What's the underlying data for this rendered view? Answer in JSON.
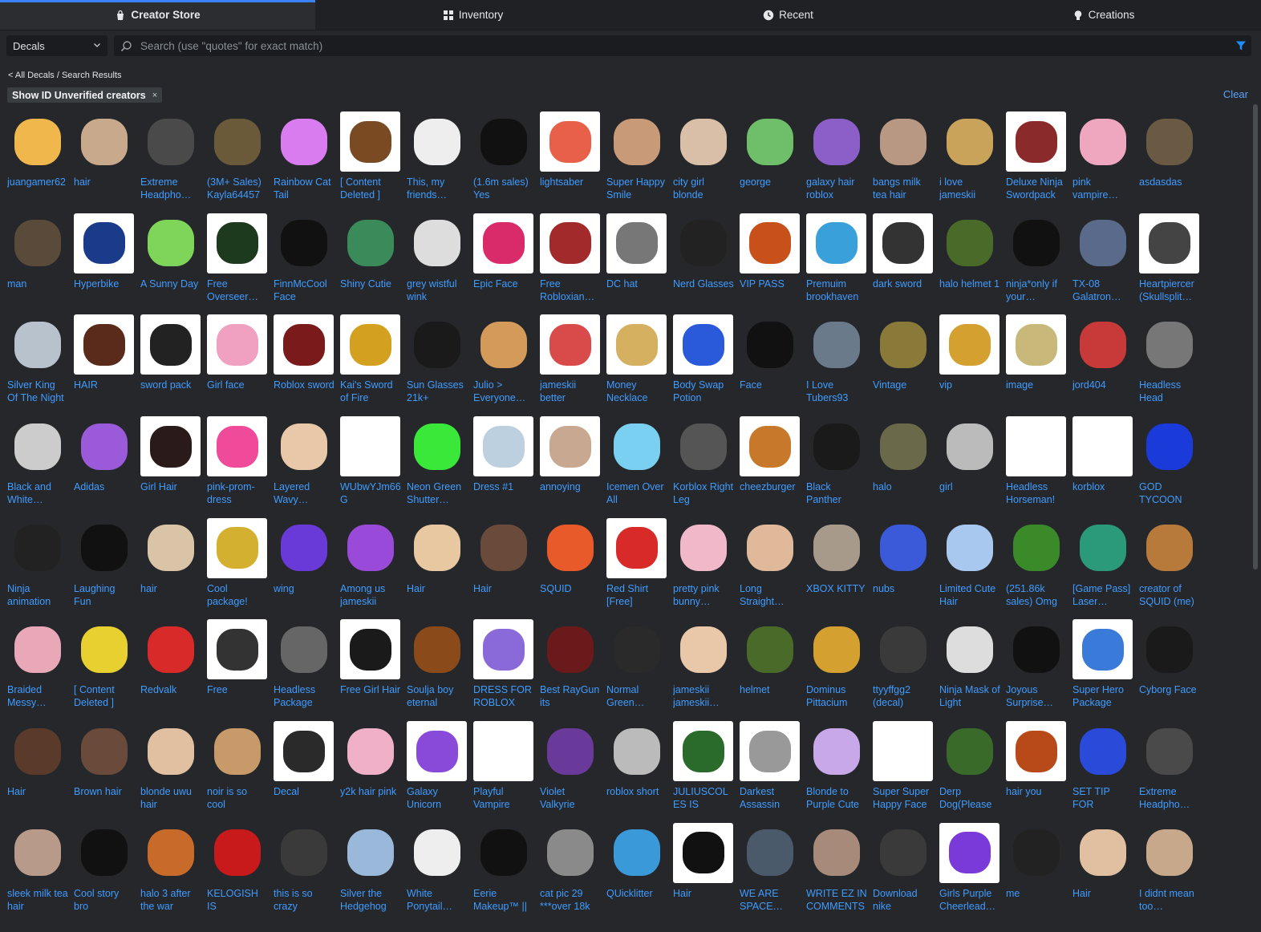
{
  "tabs": [
    {
      "label": "Creator Store",
      "icon": "bag-icon",
      "active": true
    },
    {
      "label": "Inventory",
      "icon": "grid-icon",
      "active": false
    },
    {
      "label": "Recent",
      "icon": "clock-icon",
      "active": false
    },
    {
      "label": "Creations",
      "icon": "lightbulb-icon",
      "active": false
    }
  ],
  "category": {
    "selected": "Decals"
  },
  "search": {
    "placeholder": "Search (use \"quotes\" for exact match)",
    "value": ""
  },
  "breadcrumb": {
    "back": "< All Decals",
    "separator": " / ",
    "current": "Search Results"
  },
  "filter_chip": {
    "label": "Show ID Unverified creators",
    "close": "×"
  },
  "clear_label": "Clear",
  "colors": {
    "accent": "#3b82f6",
    "link": "#3f9cff",
    "background": "#25272b"
  },
  "items": [
    {
      "name": "juangamer62",
      "bg": "#f0b84c",
      "thumb": "dark"
    },
    {
      "name": "hair",
      "bg": "#c9a98b",
      "thumb": "dark"
    },
    {
      "name": "Extreme Headpho…",
      "bg": "#4a4a4a",
      "thumb": "dark"
    },
    {
      "name": "(3M+ Sales) Kayla64457",
      "bg": "#6b5a3a",
      "thumb": "dark"
    },
    {
      "name": "Rainbow Cat Tail",
      "bg": "#d97cf0",
      "thumb": "dark"
    },
    {
      "name": "[ Content Deleted ]",
      "bg": "#7a4a22",
      "thumb": "white"
    },
    {
      "name": "This, my friends…",
      "bg": "#eeeeee",
      "thumb": "dark"
    },
    {
      "name": "(1.6m sales) Yes",
      "bg": "#111111",
      "thumb": "dark"
    },
    {
      "name": "lightsaber",
      "bg": "#e8604a",
      "thumb": "white"
    },
    {
      "name": "Super Happy Smile",
      "bg": "#c89a78",
      "thumb": "dark"
    },
    {
      "name": "city girl blonde",
      "bg": "#d9bfa8",
      "thumb": "dark"
    },
    {
      "name": "george",
      "bg": "#6fbf6a",
      "thumb": "dark"
    },
    {
      "name": "galaxy hair roblox",
      "bg": "#8b5fc7",
      "thumb": "dark"
    },
    {
      "name": "bangs milk tea hair",
      "bg": "#b89882",
      "thumb": "dark"
    },
    {
      "name": "i love jameskii",
      "bg": "#c9a35a",
      "thumb": "dark"
    },
    {
      "name": "Deluxe Ninja Swordpack",
      "bg": "#8a2a2a",
      "thumb": "white"
    },
    {
      "name": "pink vampire…",
      "bg": "#efa6bf",
      "thumb": "dark"
    },
    {
      "name": "asdasdas",
      "bg": "#6a5a44",
      "thumb": "dark"
    },
    {
      "name": "man",
      "bg": "#5a4a3a",
      "thumb": "dark"
    },
    {
      "name": "Hyperbike",
      "bg": "#1a3a8a",
      "thumb": "white"
    },
    {
      "name": "A Sunny Day",
      "bg": "#7fd45a",
      "thumb": "dark"
    },
    {
      "name": "Free Overseer…",
      "bg": "#1e3a1e",
      "thumb": "white"
    },
    {
      "name": "FinnMcCool Face",
      "bg": "#111111",
      "thumb": "dark"
    },
    {
      "name": "Shiny Cutie",
      "bg": "#3a8a5a",
      "thumb": "dark"
    },
    {
      "name": "grey wistful wink",
      "bg": "#dddddd",
      "thumb": "dark"
    },
    {
      "name": "Epic Face",
      "bg": "#d92a6a",
      "thumb": "white"
    },
    {
      "name": "Free Robloxian…",
      "bg": "#a22a2a",
      "thumb": "white"
    },
    {
      "name": "DC hat",
      "bg": "#777777",
      "thumb": "white"
    },
    {
      "name": "Nerd Glasses",
      "bg": "#222222",
      "thumb": "dark"
    },
    {
      "name": "VIP PASS",
      "bg": "#c8501a",
      "thumb": "white"
    },
    {
      "name": "Premuim brookhaven",
      "bg": "#3aa0d9",
      "thumb": "white"
    },
    {
      "name": "dark sword",
      "bg": "#333333",
      "thumb": "white"
    },
    {
      "name": "halo helmet 1",
      "bg": "#4a6a2a",
      "thumb": "dark"
    },
    {
      "name": "ninja*only if your…",
      "bg": "#111111",
      "thumb": "dark"
    },
    {
      "name": "TX-08 Galatron…",
      "bg": "#5a6a8a",
      "thumb": "dark"
    },
    {
      "name": "Heartpiercer (Skullsplit…",
      "bg": "#444444",
      "thumb": "white"
    },
    {
      "name": "Silver King Of The Night",
      "bg": "#b8c2cc",
      "thumb": "dark"
    },
    {
      "name": "HAIR",
      "bg": "#5a2a1a",
      "thumb": "white"
    },
    {
      "name": "sword pack",
      "bg": "#222222",
      "thumb": "white"
    },
    {
      "name": "Girl face",
      "bg": "#f0a0c0",
      "thumb": "white"
    },
    {
      "name": "Roblox sword",
      "bg": "#7a1a1a",
      "thumb": "white"
    },
    {
      "name": "Kai's Sword of Fire",
      "bg": "#d4a020",
      "thumb": "white"
    },
    {
      "name": "Sun Glasses 21k+",
      "bg": "#1a1a1a",
      "thumb": "dark"
    },
    {
      "name": "Julio > Everyone…",
      "bg": "#d49a5a",
      "thumb": "dark"
    },
    {
      "name": "jameskii better",
      "bg": "#d94a4a",
      "thumb": "white"
    },
    {
      "name": "Money Necklace",
      "bg": "#d4b060",
      "thumb": "white"
    },
    {
      "name": "Body Swap Potion",
      "bg": "#2a5ad9",
      "thumb": "white"
    },
    {
      "name": "Face",
      "bg": "#111111",
      "thumb": "dark"
    },
    {
      "name": "I Love Tubers93",
      "bg": "#6a7a8a",
      "thumb": "dark"
    },
    {
      "name": "Vintage",
      "bg": "#8a7a3a",
      "thumb": "dark"
    },
    {
      "name": "vip",
      "bg": "#d4a030",
      "thumb": "white"
    },
    {
      "name": "image",
      "bg": "#c8b87a",
      "thumb": "white"
    },
    {
      "name": "jord404",
      "bg": "#c83a3a",
      "thumb": "dark"
    },
    {
      "name": "Headless Head",
      "bg": "#777777",
      "thumb": "dark"
    },
    {
      "name": "Black and White…",
      "bg": "#cccccc",
      "thumb": "dark"
    },
    {
      "name": "Adidas",
      "bg": "#9a5ad9",
      "thumb": "dark"
    },
    {
      "name": "Girl Hair",
      "bg": "#2a1a1a",
      "thumb": "white"
    },
    {
      "name": "pink-prom-dress",
      "bg": "#f04a9a",
      "thumb": "white"
    },
    {
      "name": "Layered Wavy…",
      "bg": "#e8c8a8",
      "thumb": "dark"
    },
    {
      "name": "WUbwYJm66G",
      "bg": "#ffffff",
      "thumb": "white"
    },
    {
      "name": "Neon Green Shutter…",
      "bg": "#3ae83a",
      "thumb": "dark"
    },
    {
      "name": "Dress #1",
      "bg": "#bcd0e0",
      "thumb": "white"
    },
    {
      "name": "annoying",
      "bg": "#c8a890",
      "thumb": "white"
    },
    {
      "name": "Icemen Over All",
      "bg": "#7ad0f0",
      "thumb": "dark"
    },
    {
      "name": "Korblox Right Leg",
      "bg": "#555555",
      "thumb": "dark"
    },
    {
      "name": "cheezburger",
      "bg": "#c8782a",
      "thumb": "white"
    },
    {
      "name": "Black Panther",
      "bg": "#1a1a1a",
      "thumb": "dark"
    },
    {
      "name": "halo",
      "bg": "#6a6a4a",
      "thumb": "dark"
    },
    {
      "name": "girl",
      "bg": "#bbbbbb",
      "thumb": "dark"
    },
    {
      "name": "Headless Horseman!",
      "bg": "#ffffff",
      "thumb": "white"
    },
    {
      "name": "korblox",
      "bg": "#ffffff",
      "thumb": "white"
    },
    {
      "name": "GOD TYCOON",
      "bg": "#1a3ad9",
      "thumb": "dark"
    },
    {
      "name": "Ninja animation",
      "bg": "#222222",
      "thumb": "dark"
    },
    {
      "name": "Laughing Fun",
      "bg": "#111111",
      "thumb": "dark"
    },
    {
      "name": "hair",
      "bg": "#d9c4a8",
      "thumb": "dark"
    },
    {
      "name": "Cool package!",
      "bg": "#d4b030",
      "thumb": "white"
    },
    {
      "name": "wing",
      "bg": "#6a3ad9",
      "thumb": "dark"
    },
    {
      "name": "Among us jameskii",
      "bg": "#9a4ad9",
      "thumb": "dark"
    },
    {
      "name": "Hair",
      "bg": "#e8c8a0",
      "thumb": "dark"
    },
    {
      "name": "Hair",
      "bg": "#6a4a3a",
      "thumb": "dark"
    },
    {
      "name": "SQUID",
      "bg": "#e85a2a",
      "thumb": "dark"
    },
    {
      "name": "Red Shirt [Free]",
      "bg": "#d92a2a",
      "thumb": "white"
    },
    {
      "name": "pretty pink bunny…",
      "bg": "#f0b8c8",
      "thumb": "dark"
    },
    {
      "name": "Long Straight…",
      "bg": "#e0b89a",
      "thumb": "dark"
    },
    {
      "name": "XBOX KITTY",
      "bg": "#a89a8a",
      "thumb": "dark"
    },
    {
      "name": "nubs",
      "bg": "#3a5ad9",
      "thumb": "dark"
    },
    {
      "name": "Limited Cute Hair",
      "bg": "#a8c8f0",
      "thumb": "dark"
    },
    {
      "name": "(251.86k sales) Omg",
      "bg": "#3a8a2a",
      "thumb": "dark"
    },
    {
      "name": "[Game Pass] Laser…",
      "bg": "#2a9a7a",
      "thumb": "dark"
    },
    {
      "name": "creator of SQUID (me)",
      "bg": "#b87a3a",
      "thumb": "dark"
    },
    {
      "name": "Braided Messy…",
      "bg": "#e8a8b8",
      "thumb": "dark"
    },
    {
      "name": "[ Content Deleted ]",
      "bg": "#e8d030",
      "thumb": "dark"
    },
    {
      "name": "Redvalk",
      "bg": "#d92a2a",
      "thumb": "dark"
    },
    {
      "name": "Free",
      "bg": "#333333",
      "thumb": "white"
    },
    {
      "name": "Headless Package",
      "bg": "#666666",
      "thumb": "dark"
    },
    {
      "name": "Free Girl Hair",
      "bg": "#1a1a1a",
      "thumb": "white"
    },
    {
      "name": "Soulja boy eternal",
      "bg": "#8a4a1a",
      "thumb": "dark"
    },
    {
      "name": "DRESS FOR ROBLOX",
      "bg": "#8a6ad9",
      "thumb": "white"
    },
    {
      "name": "Best RayGun its",
      "bg": "#6a1a1a",
      "thumb": "dark"
    },
    {
      "name": "Normal Green…",
      "bg": "#2a2a2a",
      "thumb": "dark"
    },
    {
      "name": "jameskii jameskii…",
      "bg": "#e8c8a8",
      "thumb": "dark"
    },
    {
      "name": "helmet",
      "bg": "#4a6a2a",
      "thumb": "dark"
    },
    {
      "name": "Dominus Pittacium",
      "bg": "#d4a030",
      "thumb": "dark"
    },
    {
      "name": "ttyyffgg2 (decal)",
      "bg": "#3a3a3a",
      "thumb": "dark"
    },
    {
      "name": "Ninja Mask of Light",
      "bg": "#dddddd",
      "thumb": "dark"
    },
    {
      "name": "Joyous Surprise…",
      "bg": "#111111",
      "thumb": "dark"
    },
    {
      "name": "Super Hero Package",
      "bg": "#3a7ad9",
      "thumb": "white"
    },
    {
      "name": "Cyborg Face",
      "bg": "#1a1a1a",
      "thumb": "dark"
    },
    {
      "name": "Hair",
      "bg": "#5a3a2a",
      "thumb": "dark"
    },
    {
      "name": "Brown hair",
      "bg": "#6a4a3a",
      "thumb": "dark"
    },
    {
      "name": "blonde uwu hair",
      "bg": "#e0c0a0",
      "thumb": "dark"
    },
    {
      "name": "noir is so cool",
      "bg": "#c89a6a",
      "thumb": "dark"
    },
    {
      "name": "Decal",
      "bg": "#2a2a2a",
      "thumb": "white"
    },
    {
      "name": "y2k hair pink",
      "bg": "#f0b0c8",
      "thumb": "dark"
    },
    {
      "name": "Galaxy Unicorn",
      "bg": "#8a4ad9",
      "thumb": "white"
    },
    {
      "name": "Playful Vampire",
      "bg": "#ffffff",
      "thumb": "white"
    },
    {
      "name": "Violet Valkyrie",
      "bg": "#6a3a9a",
      "thumb": "dark"
    },
    {
      "name": "roblox short",
      "bg": "#bbbbbb",
      "thumb": "dark"
    },
    {
      "name": "JULIUSCOLES IS UNBA…",
      "bg": "#2a6a2a",
      "thumb": "white"
    },
    {
      "name": "Darkest Assassin",
      "bg": "#999999",
      "thumb": "white"
    },
    {
      "name": "Blonde to Purple Cute",
      "bg": "#c8a8e8",
      "thumb": "dark"
    },
    {
      "name": "Super Super Happy Face",
      "bg": "#ffffff",
      "thumb": "white"
    },
    {
      "name": "Derp Dog(Please",
      "bg": "#3a6a2a",
      "thumb": "dark"
    },
    {
      "name": "hair you",
      "bg": "#b84a1a",
      "thumb": "white"
    },
    {
      "name": "SET TIP FOR SCHOOL Boy",
      "bg": "#2a4ad9",
      "thumb": "dark"
    },
    {
      "name": "Extreme Headpho…",
      "bg": "#4a4a4a",
      "thumb": "dark"
    },
    {
      "name": "sleek milk tea hair",
      "bg": "#b89a8a",
      "thumb": "dark"
    },
    {
      "name": "Cool story bro",
      "bg": "#111111",
      "thumb": "dark"
    },
    {
      "name": "halo 3 after the war",
      "bg": "#c86a2a",
      "thumb": "dark"
    },
    {
      "name": "KELOGISH IS INNOCENT.",
      "bg": "#c81a1a",
      "thumb": "dark"
    },
    {
      "name": "this is so crazy",
      "bg": "#3a3a3a",
      "thumb": "dark"
    },
    {
      "name": "Silver the Hedgehog",
      "bg": "#9ab8d9",
      "thumb": "dark"
    },
    {
      "name": "White Ponytail…",
      "bg": "#eeeeee",
      "thumb": "dark"
    },
    {
      "name": "Eerie Makeup™ ||",
      "bg": "#111111",
      "thumb": "dark"
    },
    {
      "name": "cat pic 29 ***over 18k",
      "bg": "#8a8a8a",
      "thumb": "dark"
    },
    {
      "name": "QUicklitter",
      "bg": "#3a9ad9",
      "thumb": "dark"
    },
    {
      "name": "Hair",
      "bg": "#111111",
      "thumb": "white"
    },
    {
      "name": "WE ARE SPACE…",
      "bg": "#4a5a6a",
      "thumb": "dark"
    },
    {
      "name": "WRITE EZ IN COMMENTS",
      "bg": "#a88a7a",
      "thumb": "dark"
    },
    {
      "name": "Download nike",
      "bg": "#3a3a3a",
      "thumb": "dark"
    },
    {
      "name": "Girls Purple Cheerlead…",
      "bg": "#7a3ad9",
      "thumb": "white"
    },
    {
      "name": "me",
      "bg": "#222222",
      "thumb": "dark"
    },
    {
      "name": "Hair",
      "bg": "#e0c0a0",
      "thumb": "dark"
    },
    {
      "name": "I didnt mean too…",
      "bg": "#c8a88a",
      "thumb": "dark"
    }
  ]
}
